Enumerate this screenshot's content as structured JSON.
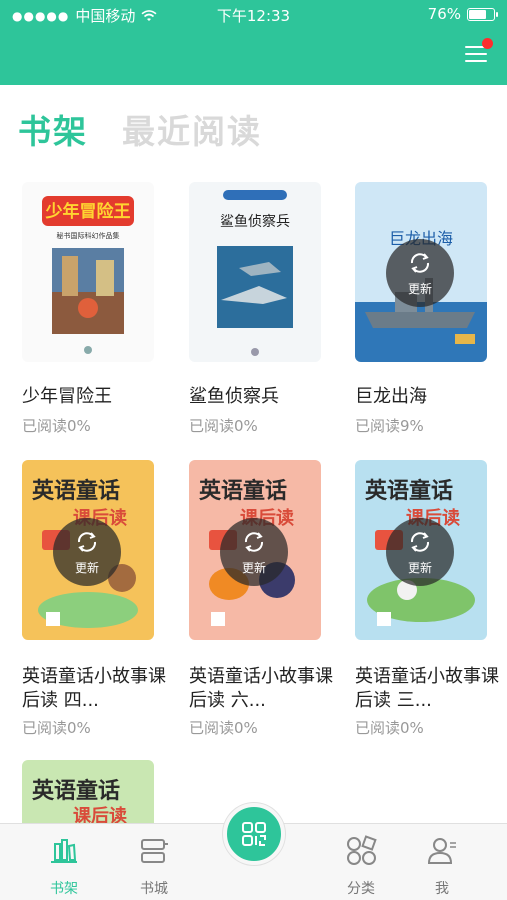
{
  "status_bar": {
    "carrier": "中国移动",
    "signal_dots": "●●●●●",
    "time": "下午12:33",
    "battery_text": "76%",
    "battery_level": 0.76
  },
  "colors": {
    "accent": "#2ec59a",
    "badge": "#ff2d2d"
  },
  "tabs": [
    {
      "label": "书架",
      "active": true
    },
    {
      "label": "最近阅读",
      "active": false
    }
  ],
  "update_label": "更新",
  "books": [
    {
      "title": "少年冒险王",
      "progress": "已阅读0%",
      "cover_text": "少年冒险王",
      "cover_sub": "秘书国际科幻作品集",
      "has_update": false
    },
    {
      "title": "鲨鱼侦察兵",
      "progress": "已阅读0%",
      "cover_text": "鲨鱼侦察兵",
      "cover_sub": "",
      "has_update": false
    },
    {
      "title": "巨龙出海",
      "progress": "已阅读9%",
      "cover_text": "巨龙出海",
      "cover_sub": "",
      "has_update": true
    },
    {
      "title": "英语童话小故事课后读 四...",
      "progress": "已阅读0%",
      "cover_text": "英语童话",
      "cover_sub": "课后读",
      "has_update": true
    },
    {
      "title": "英语童话小故事课后读 六...",
      "progress": "已阅读0%",
      "cover_text": "英语童话",
      "cover_sub": "课后读",
      "has_update": true
    },
    {
      "title": "英语童话小故事课后读 三...",
      "progress": "已阅读0%",
      "cover_text": "英语童话",
      "cover_sub": "课后读",
      "has_update": true
    },
    {
      "title": "",
      "progress": "",
      "cover_text": "英语童话",
      "cover_sub": "课后读",
      "has_update": false
    }
  ],
  "bottom_nav": [
    {
      "label": "书架",
      "icon": "bookshelf-icon",
      "active": true
    },
    {
      "label": "书城",
      "icon": "bookstore-icon",
      "active": false
    },
    {
      "label": "",
      "icon": "scan-qr-icon",
      "active": false
    },
    {
      "label": "分类",
      "icon": "category-icon",
      "active": false
    },
    {
      "label": "我",
      "icon": "profile-icon",
      "active": false
    }
  ]
}
